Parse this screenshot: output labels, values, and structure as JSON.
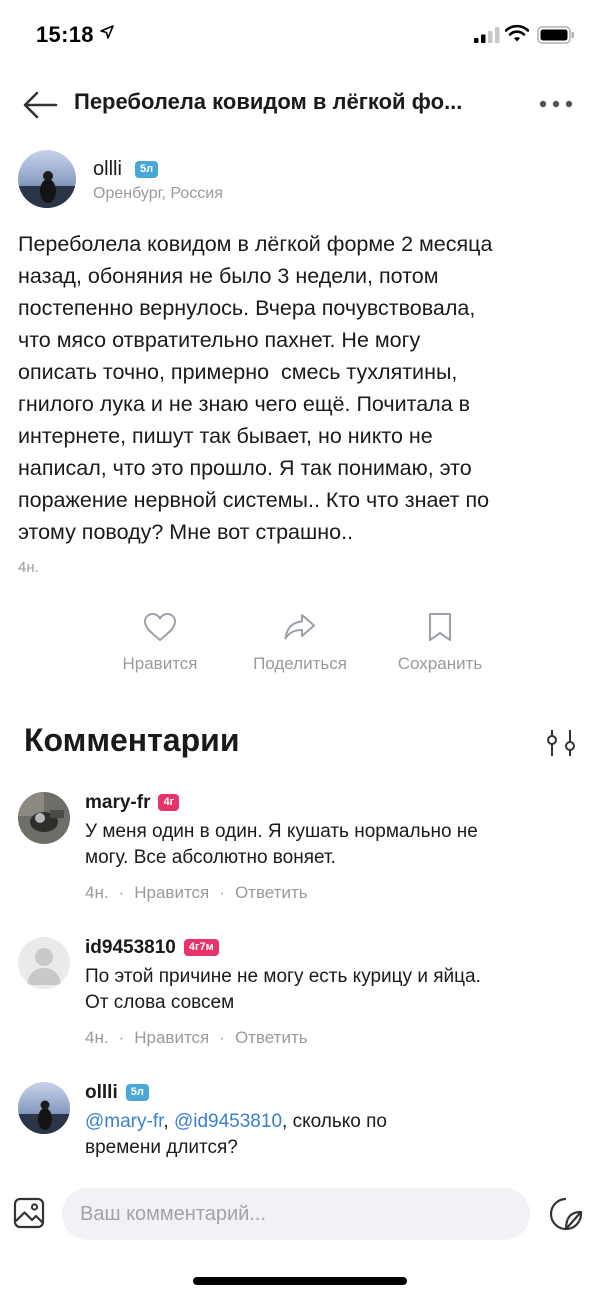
{
  "status_bar": {
    "time": "15:18",
    "icons": [
      "location-arrow-icon",
      "cellular-signal-icon",
      "wifi-icon",
      "battery-icon"
    ]
  },
  "nav": {
    "title": "Переболела ковидом в лёгкой фо...",
    "icons": [
      "back-arrow-icon",
      "more-dots-icon"
    ]
  },
  "post": {
    "author": {
      "name": "ollli",
      "badge": "5л",
      "location": "Оренбург, Россия"
    },
    "lines": [
      "Переболела ковидом в лёгкой форме 2 месяца",
      "назад, обоняния не было 3 недели, потом",
      "постепенно вернулось. Вчера почувствовала,",
      "что мясо отвратительно пахнет. Не могу",
      "описать точно, примерно  смесь тухлятины,",
      "гнилого лука и не знаю чего ещё. Почитала в",
      "интернете, пишут так бывает, но никто не",
      "написал, что это прошло. Я так понимаю, это",
      "поражение нервной системы.. Кто что знает по",
      "этому поводу? Мне вот страшно.."
    ],
    "time": "4н.",
    "actions": {
      "like": "Нравится",
      "share": "Поделиться",
      "save": "Сохранить"
    }
  },
  "comments": {
    "title": "Комментарии",
    "items": [
      {
        "author": "mary-fr",
        "badge": "4г",
        "lines": [
          "У меня один в один. Я кушать нормально не",
          "могу. Все абсолютно воняет."
        ],
        "time": "4н.",
        "like": "Нравится",
        "reply": "Ответить"
      },
      {
        "author": "id9453810",
        "badge": "4г7м",
        "lines": [
          "По этой причине не могу есть курицу и яйца.",
          "От слова совсем"
        ],
        "time": "4н.",
        "like": "Нравится",
        "reply": "Ответить"
      },
      {
        "author": "ollli",
        "badge": "5л",
        "mention_1": "@mary-fr",
        "separator": ", ",
        "mention_2": "@id9453810",
        "text_after": ", сколько по",
        "line_2": "времени длится?"
      }
    ]
  },
  "composer": {
    "placeholder": "Ваш комментарий..."
  },
  "colors": {
    "accent": "#3a7fd1",
    "badge_blue": "#4aa8d8",
    "badge_red": "#e8336a",
    "muted_text": "#9a9a9a",
    "input_bg": "#f1f2f5"
  }
}
